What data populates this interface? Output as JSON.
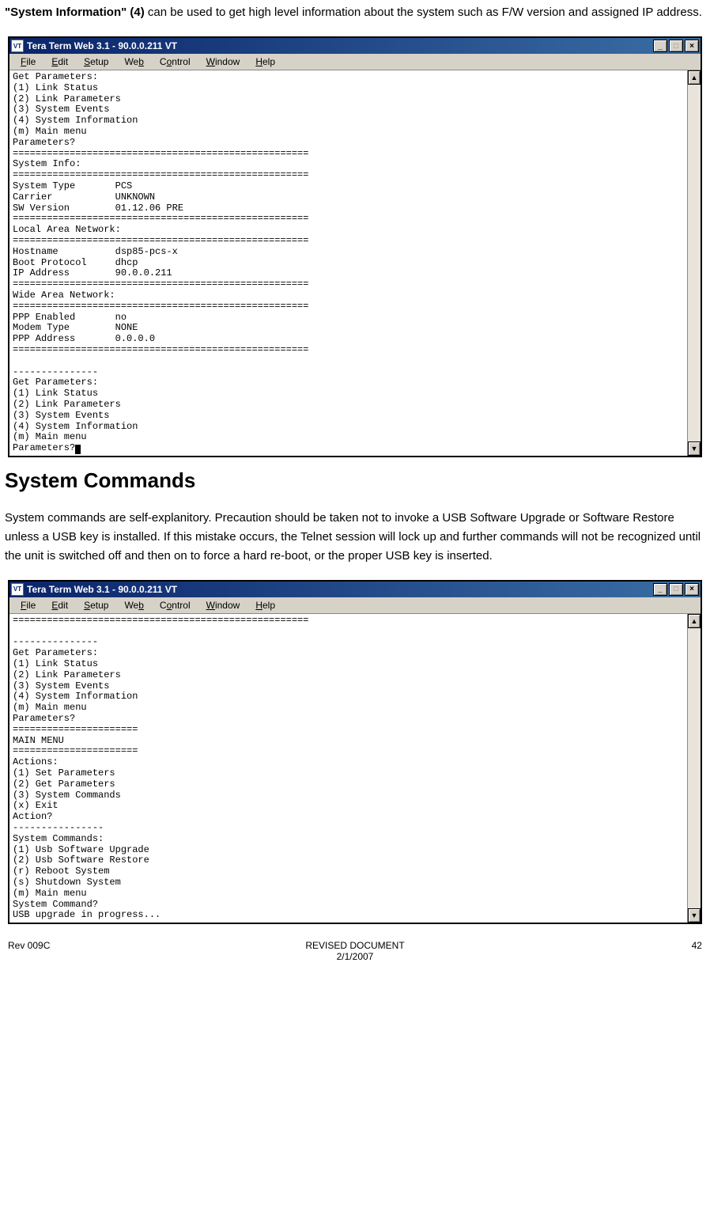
{
  "intro": {
    "bold": "\"System Information\" (4)",
    "rest": " can be used to get high level information about the system such as F/W version and assigned IP address."
  },
  "window1": {
    "title": "Tera Term Web 3.1 - 90.0.0.211 VT",
    "terminal_lines": [
      "Get Parameters:",
      "(1) Link Status",
      "(2) Link Parameters",
      "(3) System Events",
      "(4) System Information",
      "(m) Main menu",
      "Parameters?",
      "====================================================",
      "System Info:",
      "====================================================",
      "System Type       PCS",
      "Carrier           UNKNOWN",
      "SW Version        01.12.06 PRE",
      "====================================================",
      "Local Area Network:",
      "====================================================",
      "Hostname          dsp85-pcs-x",
      "Boot Protocol     dhcp",
      "IP Address        90.0.0.211",
      "====================================================",
      "Wide Area Network:",
      "====================================================",
      "PPP Enabled       no",
      "Modem Type        NONE",
      "PPP Address       0.0.0.0",
      "====================================================",
      "",
      "---------------",
      "Get Parameters:",
      "(1) Link Status",
      "(2) Link Parameters",
      "(3) System Events",
      "(4) System Information",
      "(m) Main menu",
      "Parameters?"
    ]
  },
  "heading": "System Commands",
  "paragraph": "System commands are self-explanitory. Precaution should be taken not to invoke a USB Software Upgrade or Software Restore unless a USB key is installed. If this mistake occurs, the Telnet session will lock up and further commands will not be recognized until the unit is switched off and then on  to force a hard re-boot, or the proper USB key is inserted.",
  "window2": {
    "title": "Tera Term Web 3.1 - 90.0.0.211 VT",
    "terminal_lines": [
      "====================================================",
      "",
      "---------------",
      "Get Parameters:",
      "(1) Link Status",
      "(2) Link Parameters",
      "(3) System Events",
      "(4) System Information",
      "(m) Main menu",
      "Parameters?",
      "======================",
      "MAIN MENU",
      "======================",
      "Actions:",
      "(1) Set Parameters",
      "(2) Get Parameters",
      "(3) System Commands",
      "(x) Exit",
      "Action?",
      "----------------",
      "System Commands:",
      "(1) Usb Software Upgrade",
      "(2) Usb Software Restore",
      "(r) Reboot System",
      "(s) Shutdown System",
      "(m) Main menu",
      "System Command?",
      "USB upgrade in progress..."
    ]
  },
  "menu": {
    "items": [
      {
        "pre": "",
        "ul": "F",
        "post": "ile"
      },
      {
        "pre": "",
        "ul": "E",
        "post": "dit"
      },
      {
        "pre": "",
        "ul": "S",
        "post": "etup"
      },
      {
        "pre": "We",
        "ul": "b",
        "post": ""
      },
      {
        "pre": "C",
        "ul": "o",
        "post": "ntrol"
      },
      {
        "pre": "",
        "ul": "W",
        "post": "indow"
      },
      {
        "pre": "",
        "ul": "H",
        "post": "elp"
      }
    ]
  },
  "winbtns": {
    "min": "_",
    "max": "□",
    "close": "×"
  },
  "scroll": {
    "up": "▲",
    "down": "▼"
  },
  "footer": {
    "left": "Rev 009C",
    "center1": "REVISED DOCUMENT",
    "center2": "2/1/2007",
    "right": "42"
  }
}
